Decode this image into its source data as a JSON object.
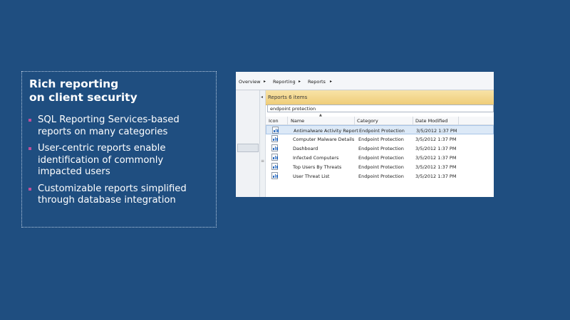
{
  "slide": {
    "heading_line1": "Rich reporting",
    "heading_line2": "on client security",
    "bullets": [
      {
        "line1": "SQL Reporting Services-based",
        "line2": "reports on many categories"
      },
      {
        "line1": "User-centric reports enable",
        "line2": "identification of commonly",
        "line3": "impacted users"
      },
      {
        "line1": "Customizable reports simplified",
        "line2": "through database integration"
      }
    ],
    "bullet_color": "#c0509a",
    "background_color": "#1f4e80"
  },
  "screenshot": {
    "breadcrumbs": [
      "Overview",
      "Reporting",
      "Reports"
    ],
    "breadcrumb_separator": "▸",
    "reports_bar_label": "Reports 6 items",
    "search_value": "endpoint protection",
    "collapse_glyph": "◂",
    "grip_glyph": "≡",
    "sort_indicator": "▲",
    "columns": [
      "Icon",
      "Name",
      "Category",
      "Date Modified"
    ],
    "rows": [
      {
        "icon": "report-icon",
        "name": "Antimalware Activity Report",
        "category": "Endpoint Protection",
        "date": "3/5/2012 1:37 PM",
        "selected": true
      },
      {
        "icon": "report-icon",
        "name": "Computer Malware Details",
        "category": "Endpoint Protection",
        "date": "3/5/2012 1:37 PM"
      },
      {
        "icon": "report-icon",
        "name": "Dashboard",
        "category": "Endpoint Protection",
        "date": "3/5/2012 1:37 PM"
      },
      {
        "icon": "report-icon",
        "name": "Infected Computers",
        "category": "Endpoint Protection",
        "date": "3/5/2012 1:37 PM"
      },
      {
        "icon": "report-icon",
        "name": "Top Users By Threats",
        "category": "Endpoint Protection",
        "date": "3/5/2012 1:37 PM"
      },
      {
        "icon": "report-icon",
        "name": "User Threat List",
        "category": "Endpoint Protection",
        "date": "3/5/2012 1:37 PM"
      }
    ],
    "accent_color": "#efcd79"
  }
}
